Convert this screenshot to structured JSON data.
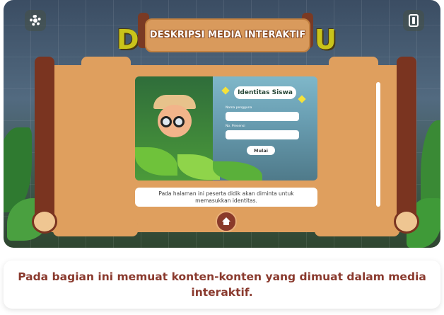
{
  "header": {
    "title": "DESKRIPSI MEDIA INTERAKTIF",
    "letter_left": "D",
    "letter_right": "U"
  },
  "toolbar": {
    "settings_icon": "gear-icon",
    "exit_icon": "exit-door-icon"
  },
  "preview": {
    "form_title": "Identitas Siswa",
    "field_name_label": "Nama pengguna",
    "field_attendance_label": "No. Presensi",
    "start_button": "Mulai"
  },
  "content": {
    "caption": "Pada halaman ini peserta didik akan diminta untuk memasukkan identitas.",
    "home_icon": "home-icon"
  },
  "footer": {
    "text": "Pada bagian ini memuat konten-konten yang dimuat dalam media interaktif."
  },
  "colors": {
    "scroll": "#df9f5e",
    "rod": "#7a3420",
    "footer_text": "#8a3a2e",
    "letter": "#c9c41a"
  }
}
